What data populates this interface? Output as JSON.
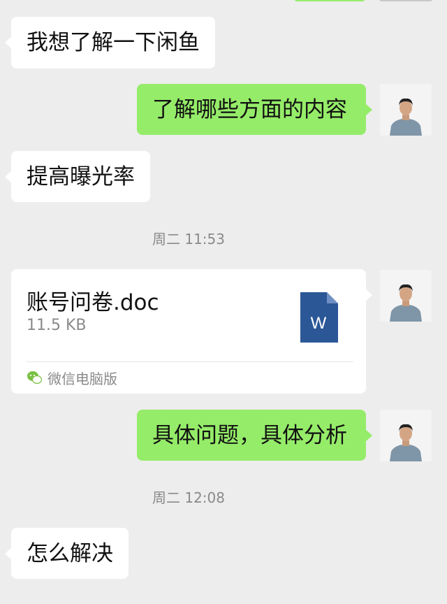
{
  "messages": [
    {
      "side": "in",
      "text": "我想了解一下闲鱼"
    },
    {
      "side": "out",
      "text": "了解哪些方面的内容"
    },
    {
      "side": "in",
      "text": "提高曝光率"
    },
    {
      "type": "time",
      "text": "周二 11:53"
    },
    {
      "side": "out",
      "type": "file",
      "file_name": "账号问卷.doc",
      "file_size": "11.5 KB",
      "file_icon_letter": "W",
      "source": "微信电脑版"
    },
    {
      "side": "out",
      "text": "具体问题，具体分析"
    },
    {
      "type": "time",
      "text": "周二 12:08"
    },
    {
      "side": "in",
      "text": "怎么解决"
    }
  ],
  "colors": {
    "background": "#ededed",
    "outgoing_bubble": "#95ec69",
    "incoming_bubble": "#ffffff",
    "word_icon": "#2b5797",
    "wechat_green": "#7bc143"
  },
  "icons": {
    "word_file": "word-doc-icon",
    "wechat": "wechat-logo-icon"
  }
}
